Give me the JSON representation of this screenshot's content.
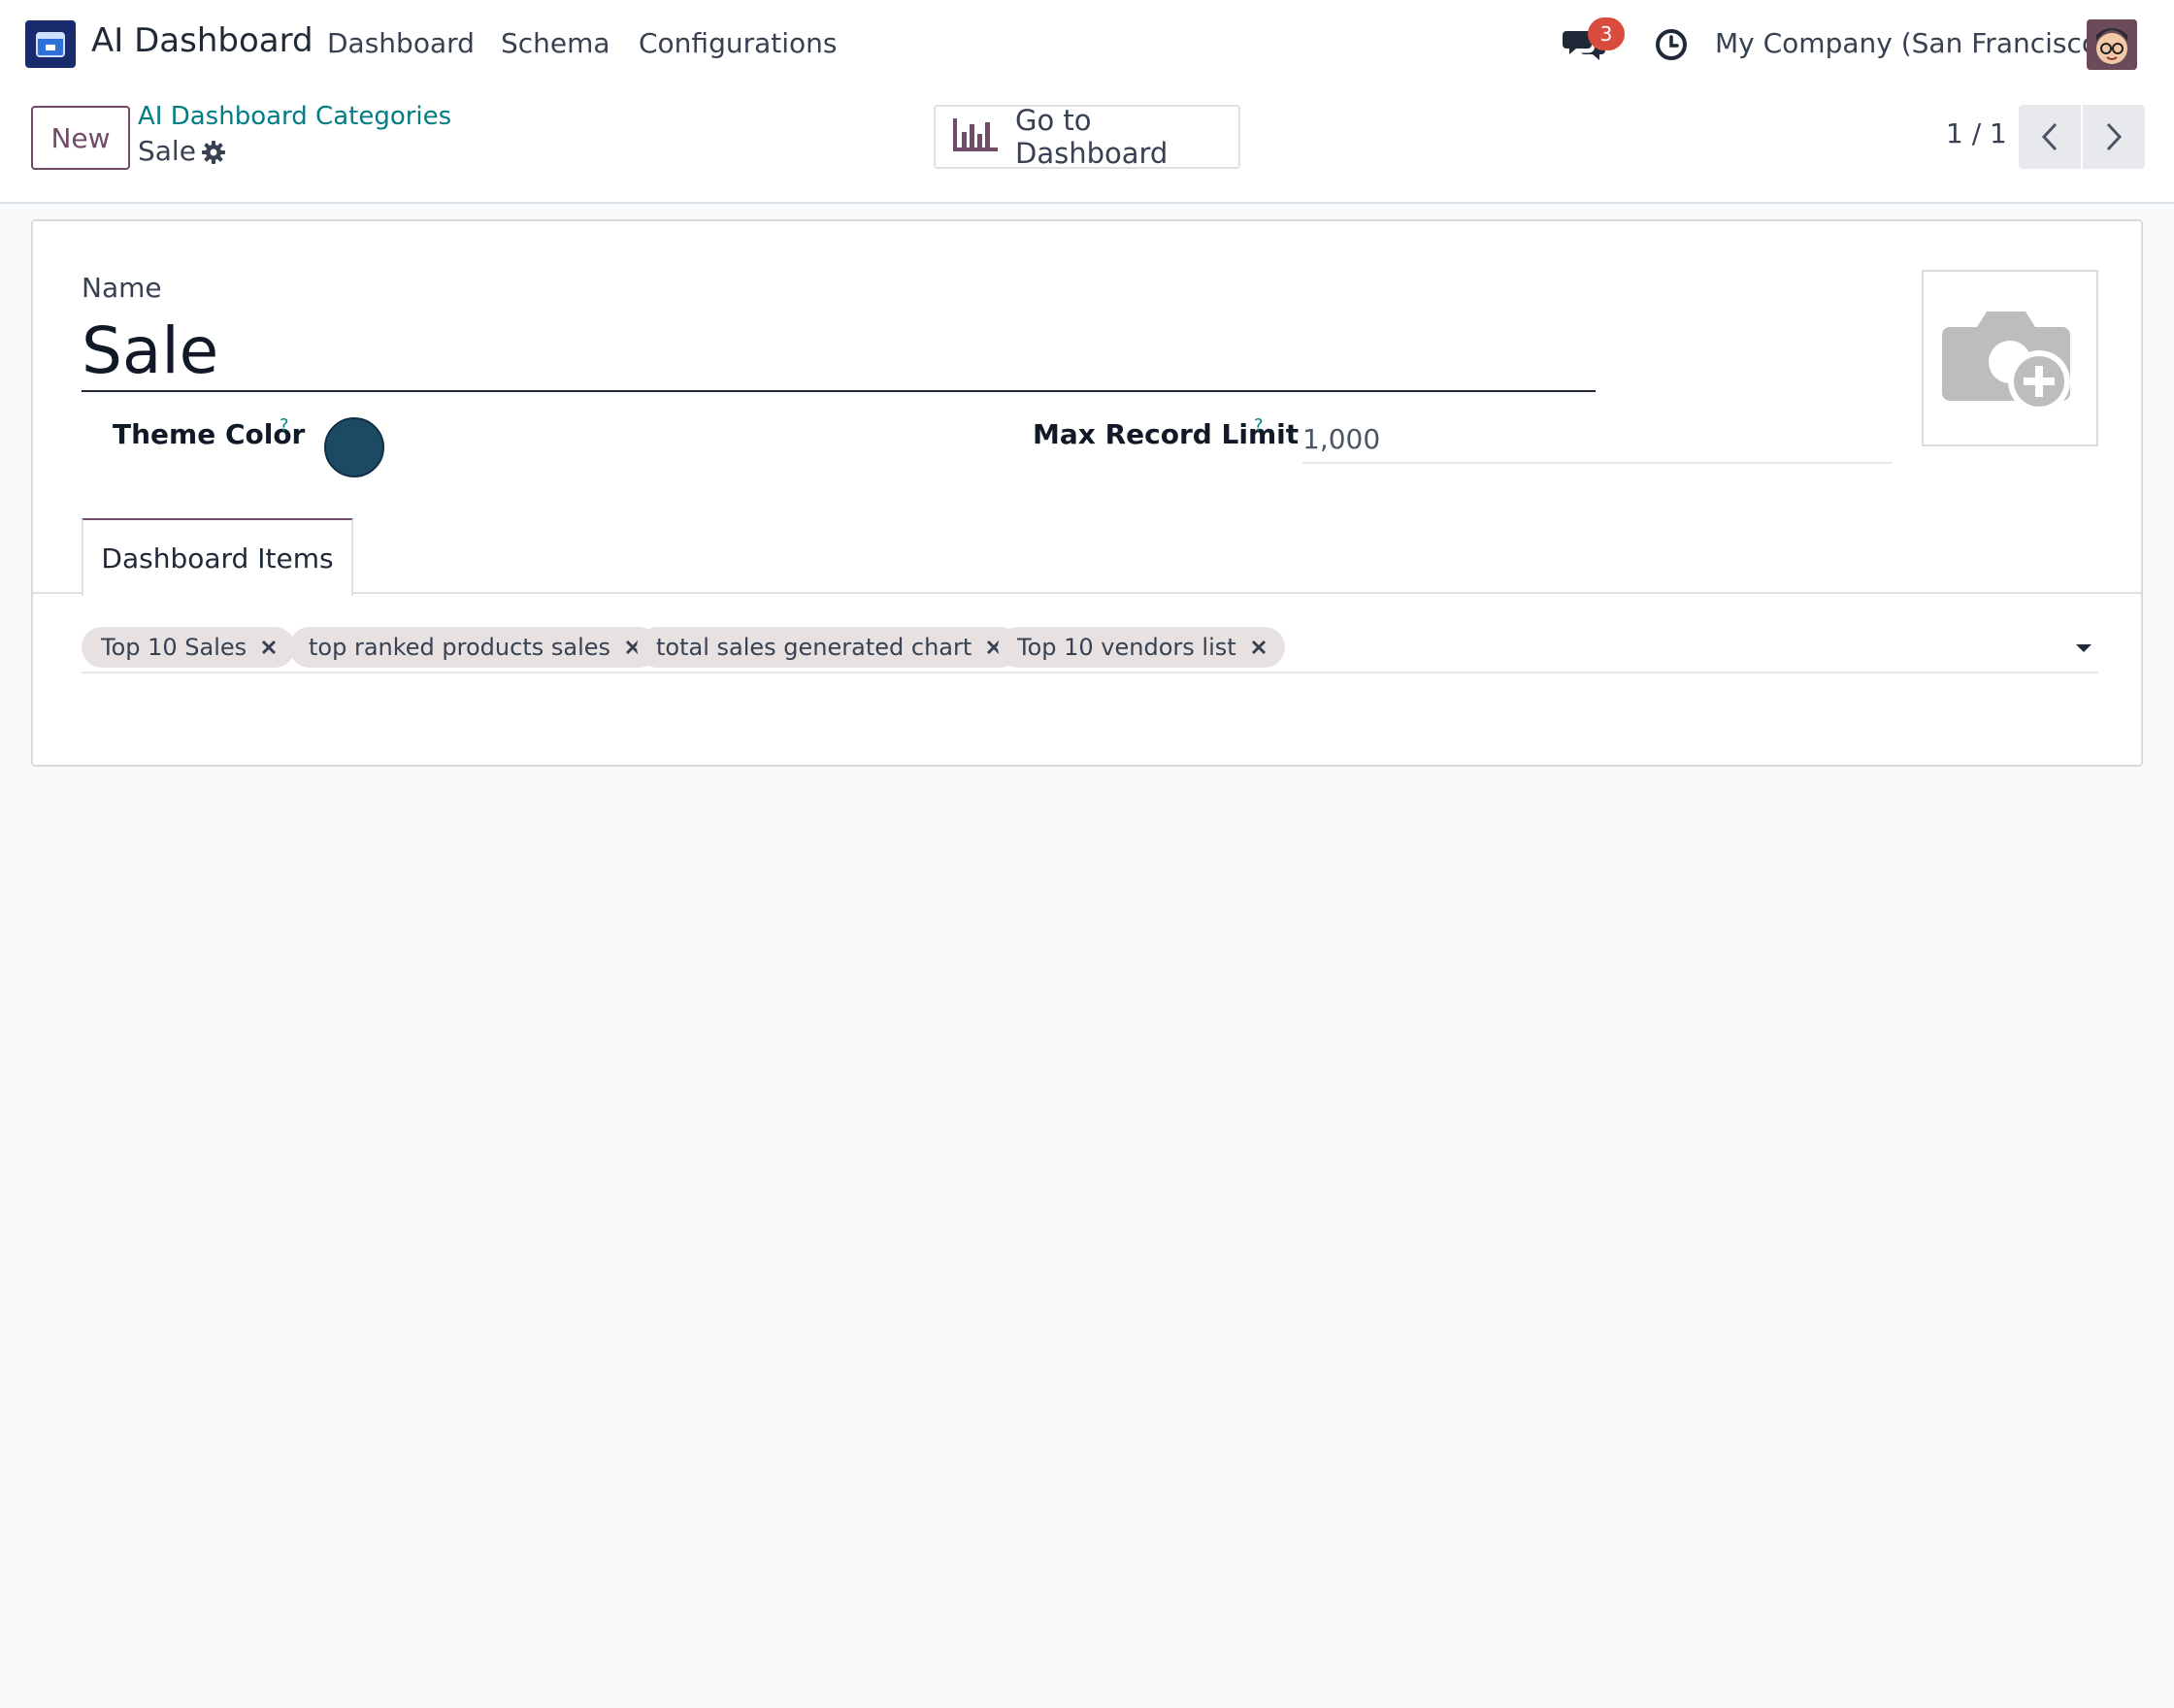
{
  "navbar": {
    "app_name": "AI Dashboard",
    "menu": [
      "Dashboard",
      "Schema",
      "Configurations"
    ],
    "chat_badge": "3",
    "company": "My Company (San Francisco)"
  },
  "control_panel": {
    "new_label": "New",
    "breadcrumb_parent": "AI Dashboard Categories",
    "breadcrumb_current": "Sale",
    "goto_dashboard_label": "Go to Dashboard",
    "pager": "1 / 1"
  },
  "form": {
    "name_label": "Name",
    "name_value": "Sale",
    "theme_color_label": "Theme Color",
    "theme_color_value": "#1c4a63",
    "help_mark": "?",
    "max_record_label": "Max Record Limit",
    "max_record_value": "1,000",
    "tab_label": "Dashboard Items",
    "dashboard_items": [
      "Top 10 Sales",
      "top ranked products sales",
      "total sales generated chart",
      "Top 10 vendors list"
    ]
  },
  "colors": {
    "brand": "#714b67",
    "link": "#017e84",
    "badge": "#d94a3f"
  }
}
